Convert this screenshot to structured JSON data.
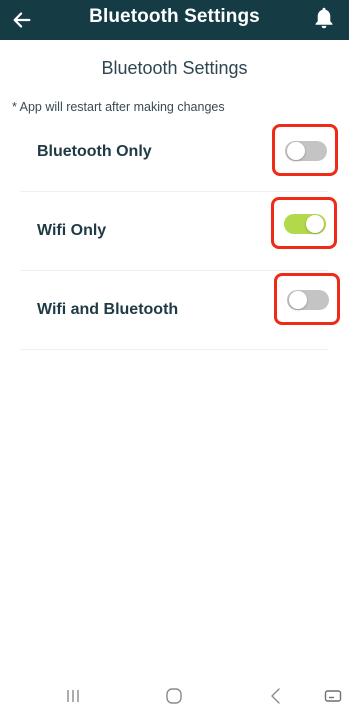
{
  "app_bar": {
    "title": "Bluetooth Settings",
    "back_icon": "arrow-left-icon",
    "notification_icon": "bell-icon",
    "background": "#153b45"
  },
  "main": {
    "heading": "Bluetooth Settings",
    "note": "* App will restart after making changes",
    "settings": [
      {
        "label": "Bluetooth Only",
        "enabled": false
      },
      {
        "label": "Wifi Only",
        "enabled": true
      },
      {
        "label": "Wifi and Bluetooth",
        "enabled": false
      }
    ]
  },
  "colors": {
    "toggle_on": "#b2d94a",
    "toggle_off": "#c4c4c4",
    "highlight_border": "#ef2a16"
  },
  "system_nav": {
    "icons": [
      "recent-apps-icon",
      "home-icon",
      "back-icon",
      "keyboard-icon"
    ]
  }
}
